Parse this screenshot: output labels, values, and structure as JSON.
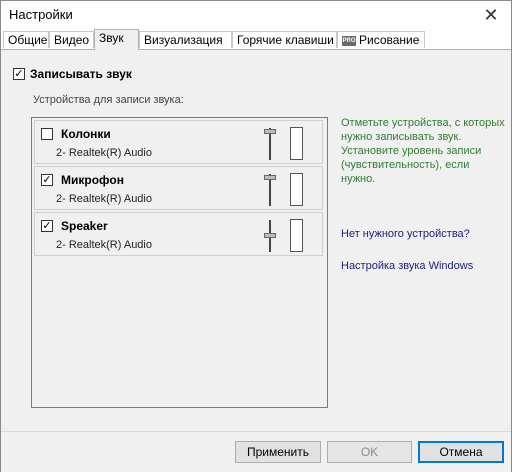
{
  "window": {
    "title": "Настройки",
    "close_glyph": "✕"
  },
  "tabs": [
    {
      "label": "Общие"
    },
    {
      "label": "Видео"
    },
    {
      "label": "Звук"
    },
    {
      "label": "Визуализация"
    },
    {
      "label": "Горячие клавиши"
    },
    {
      "label": "Рисование",
      "icon": "pro-badge-icon",
      "icon_text": "PRO"
    }
  ],
  "active_tab": "Звук",
  "sound": {
    "record_label": "Записывать звук",
    "record_checked": true,
    "devices_caption": "Устройства для записи звука:",
    "devices": [
      {
        "name": "Колонки",
        "sub": "2- Realtek(R) Audio",
        "checked": false,
        "check_glyph": ""
      },
      {
        "name": "Микрофон",
        "sub": "2- Realtek(R) Audio",
        "checked": true,
        "check_glyph": "✓"
      },
      {
        "name": "Speaker",
        "sub": "2- Realtek(R) Audio",
        "checked": true,
        "check_glyph": "✓"
      }
    ],
    "help_text": "Отметьте устройства, с которых нужно записывать звук.\nУстановите уровень записи (чувствительность), если нужно.",
    "link_missing": "Нет нужного устройства?",
    "link_windows": "Настройка звука Windows"
  },
  "buttons": {
    "apply": "Применить",
    "ok": "OK",
    "cancel": "Отмена"
  },
  "colors": {
    "help_text": "#2e7d32",
    "link": "#1a237e",
    "focus": "#0078d7"
  }
}
